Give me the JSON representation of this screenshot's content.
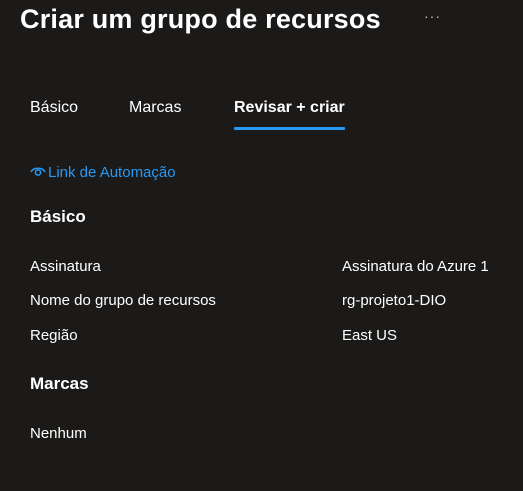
{
  "header": {
    "title": "Criar um grupo de recursos",
    "more_label": "···"
  },
  "tabs": [
    {
      "label": "Básico",
      "active": false
    },
    {
      "label": "Marcas",
      "active": false
    },
    {
      "label": "Revisar + criar",
      "active": true
    }
  ],
  "automation_link": {
    "label": "Link de Automação",
    "icon": "eye-icon",
    "color": "#2899f5"
  },
  "sections": {
    "basics": {
      "title": "Básico",
      "rows": [
        {
          "label": "Assinatura",
          "value": "Assinatura do Azure 1"
        },
        {
          "label": "Nome do grupo de recursos",
          "value": "rg-projeto1-DIO"
        },
        {
          "label": "Região",
          "value": "East US"
        }
      ]
    },
    "tags": {
      "title": "Marcas",
      "empty_text": "Nenhum"
    }
  },
  "colors": {
    "background": "#1b1a19",
    "accent": "#2899f5",
    "text": "#ffffff"
  }
}
